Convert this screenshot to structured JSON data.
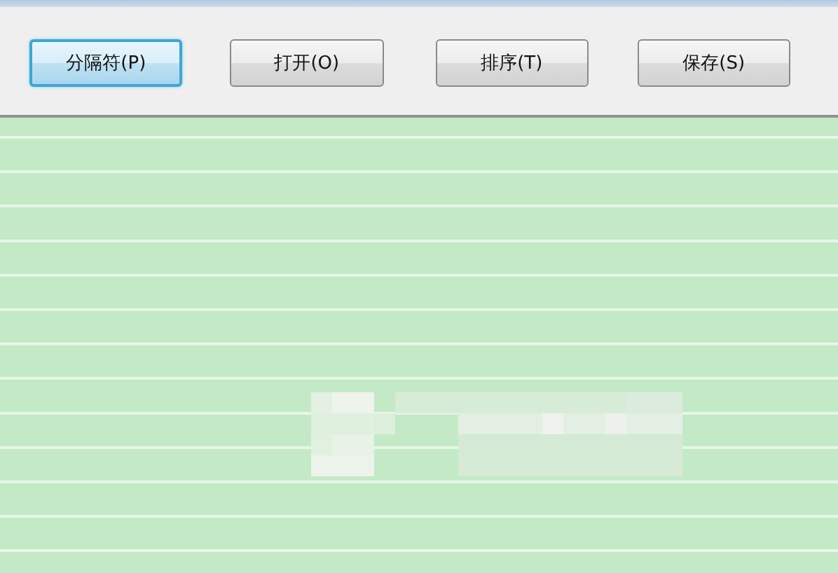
{
  "toolbar": {
    "buttons": [
      {
        "label": "分隔符(P)",
        "focused": true
      },
      {
        "label": "打开(O)",
        "focused": false
      },
      {
        "label": "排序(T)",
        "focused": false
      },
      {
        "label": "保存(S)",
        "focused": false
      }
    ]
  }
}
